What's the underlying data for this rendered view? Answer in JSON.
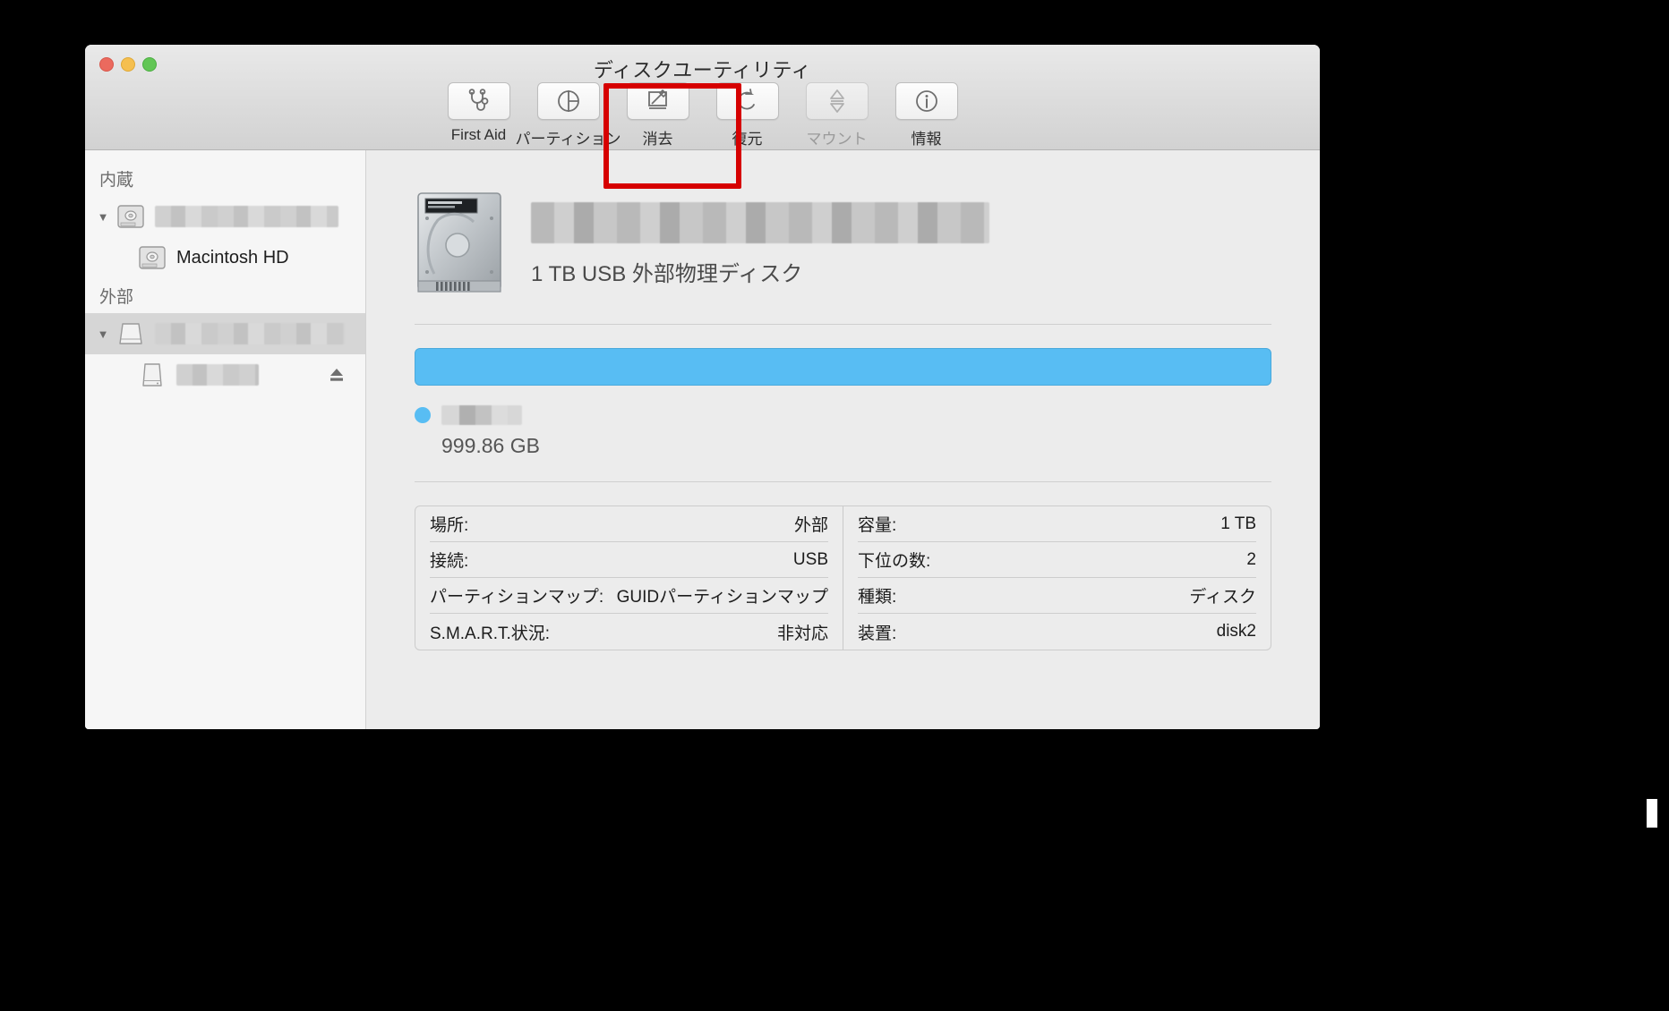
{
  "window": {
    "title": "ディスクユーティリティ",
    "traffic_lights": [
      "close",
      "minimize",
      "zoom"
    ]
  },
  "toolbar": {
    "items": [
      {
        "label": "First Aid",
        "icon": "stethoscope-icon",
        "enabled": true,
        "highlighted": false
      },
      {
        "label": "パーティション",
        "icon": "pie-chart-icon",
        "enabled": true,
        "highlighted": true
      },
      {
        "label": "消去",
        "icon": "erase-icon",
        "enabled": true,
        "highlighted": false
      },
      {
        "label": "復元",
        "icon": "restore-icon",
        "enabled": true,
        "highlighted": false
      },
      {
        "label": "マウント",
        "icon": "mount-icon",
        "enabled": false,
        "highlighted": false
      },
      {
        "label": "情報",
        "icon": "info-icon",
        "enabled": true,
        "highlighted": false
      }
    ],
    "highlight_color": "#d60000"
  },
  "sidebar": {
    "sections": [
      {
        "header": "内蔵",
        "rows": [
          {
            "name": "",
            "redacted": true,
            "indent": false,
            "disclosure": "▼",
            "selected": false,
            "icon": "internal-disk-icon",
            "eject": false
          },
          {
            "name": "Macintosh HD",
            "redacted": false,
            "indent": true,
            "disclosure": "",
            "selected": false,
            "icon": "internal-disk-icon",
            "eject": false
          }
        ]
      },
      {
        "header": "外部",
        "rows": [
          {
            "name": "",
            "redacted": true,
            "indent": false,
            "disclosure": "▼",
            "selected": true,
            "icon": "external-disk-icon",
            "eject": false
          },
          {
            "name": "",
            "redacted": true,
            "indent": true,
            "disclosure": "",
            "selected": false,
            "icon": "external-volume-icon",
            "eject": true
          }
        ]
      }
    ]
  },
  "main": {
    "disk_icon": "hard-drive-image",
    "disk_name_redacted": true,
    "disk_subtitle": "1 TB USB 外部物理ディスク",
    "capacity_bar": {
      "segments": [
        {
          "color": "#58bdf3",
          "percent": 100
        }
      ]
    },
    "legend": {
      "dot_color": "#58bdf3",
      "name_redacted": true,
      "size": "999.86 GB"
    },
    "info": {
      "left": [
        {
          "key": "場所:",
          "value": "外部"
        },
        {
          "key": "接続:",
          "value": "USB"
        },
        {
          "key": "パーティションマップ:",
          "value": "GUIDパーティションマップ"
        },
        {
          "key": "S.M.A.R.T.状況:",
          "value": "非対応"
        }
      ],
      "right": [
        {
          "key": "容量:",
          "value": "1 TB"
        },
        {
          "key": "下位の数:",
          "value": "2"
        },
        {
          "key": "種類:",
          "value": "ディスク"
        },
        {
          "key": "装置:",
          "value": "disk2"
        }
      ]
    }
  }
}
